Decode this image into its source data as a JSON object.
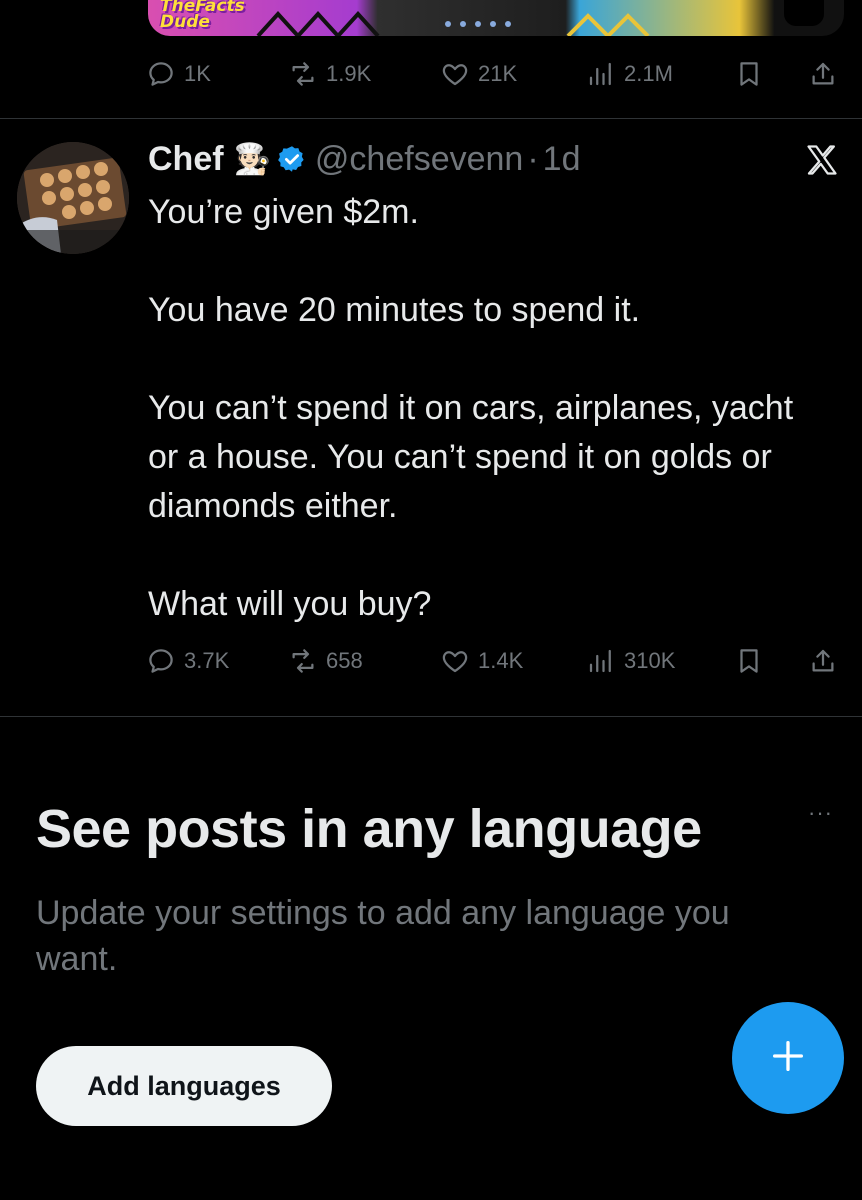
{
  "top_media": {
    "logo_text": "TheFacts\nDude"
  },
  "top_actions": {
    "replies": "1K",
    "reposts": "1.9K",
    "likes": "21K",
    "views": "2.1M"
  },
  "tweet": {
    "display_name": "Chef",
    "name_emoji": "🧑🏻‍🍳",
    "handle": "@chefsevenn",
    "separator": "·",
    "time": "1d",
    "text_lines": [
      "You’re given $2m.",
      "You have 20 minutes to spend it.",
      "You can’t spend it on cars, airplanes, yacht or a house. You can’t spend it on golds or diamonds either.",
      "What will you buy?"
    ],
    "actions": {
      "replies": "3.7K",
      "reposts": "658",
      "likes": "1.4K",
      "views": "310K"
    }
  },
  "promo": {
    "title": "See posts in any language",
    "subtitle": "Update your settings to add any language you want.",
    "more": "···",
    "button_label": "Add languages"
  },
  "colors": {
    "background": "#000000",
    "text": "#e7e9ea",
    "muted": "#71767b",
    "accent": "#1d9bf0",
    "button_bg": "#eff3f4"
  }
}
